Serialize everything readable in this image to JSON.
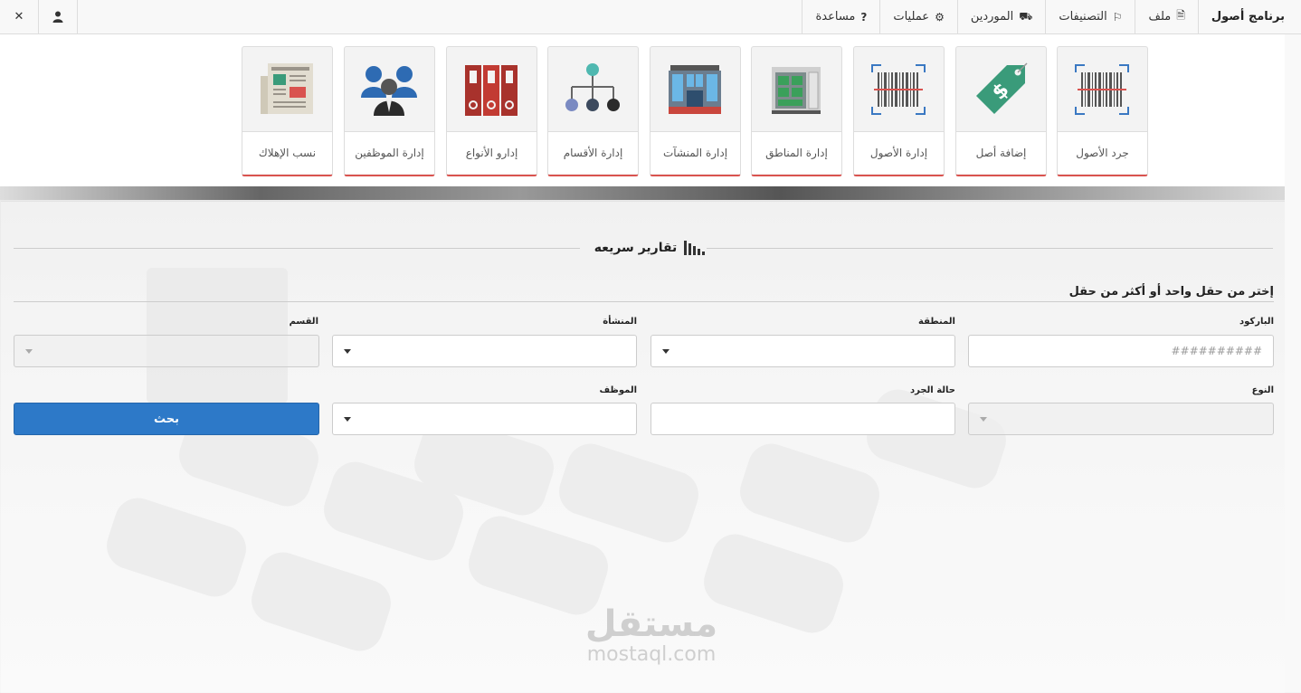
{
  "navbar": {
    "brand": "برنامج أصول",
    "menu": [
      {
        "label": "ملف",
        "icon": "file-icon"
      },
      {
        "label": "التصنيفات",
        "icon": "tags-icon"
      },
      {
        "label": "الموردين",
        "icon": "truck-icon"
      },
      {
        "label": "عمليات",
        "icon": "gears-icon"
      },
      {
        "label": "مساعدة",
        "icon": "question-icon"
      }
    ],
    "icons": {
      "file": "🗎",
      "tags": "⚐",
      "truck": "⛟",
      "gears": "⚙",
      "question": "?",
      "user": "👤",
      "close": "✕"
    }
  },
  "tiles": [
    {
      "label": "جرد الأصول",
      "icon": "barcode-icon"
    },
    {
      "label": "إضافة أصل",
      "icon": "price-tag-icon"
    },
    {
      "label": "إدارة الأصول",
      "icon": "barcode-scan-icon"
    },
    {
      "label": "إدارة المناطق",
      "icon": "building-interior-icon"
    },
    {
      "label": "إدارة المنشآت",
      "icon": "building-icon"
    },
    {
      "label": "إدارة الأقسام",
      "icon": "hierarchy-icon"
    },
    {
      "label": "إدارو الأنواع",
      "icon": "binders-icon"
    },
    {
      "label": "إدارة الموظفين",
      "icon": "employees-icon"
    },
    {
      "label": "نسب الإهلاك",
      "icon": "newspaper-icon"
    }
  ],
  "quick_reports": {
    "title": "تقارير سريعه",
    "instruction": "إختر من حقل واحد أو أكثر من حقل",
    "fields": {
      "barcode": {
        "label": "الباركود",
        "placeholder": "##########"
      },
      "region": {
        "label": "المنطقة"
      },
      "facility": {
        "label": "المنشأة"
      },
      "department": {
        "label": "القسم"
      },
      "type": {
        "label": "النوع"
      },
      "inventory_status": {
        "label": "حالة الجرد"
      },
      "employee": {
        "label": "الموظف"
      }
    },
    "search_button": "بحث"
  },
  "watermark": {
    "arabic": "مستقل",
    "latin": "mostaql.com"
  },
  "colors": {
    "accent_blue": "#2d79c8",
    "tile_border": "#d9534f"
  }
}
